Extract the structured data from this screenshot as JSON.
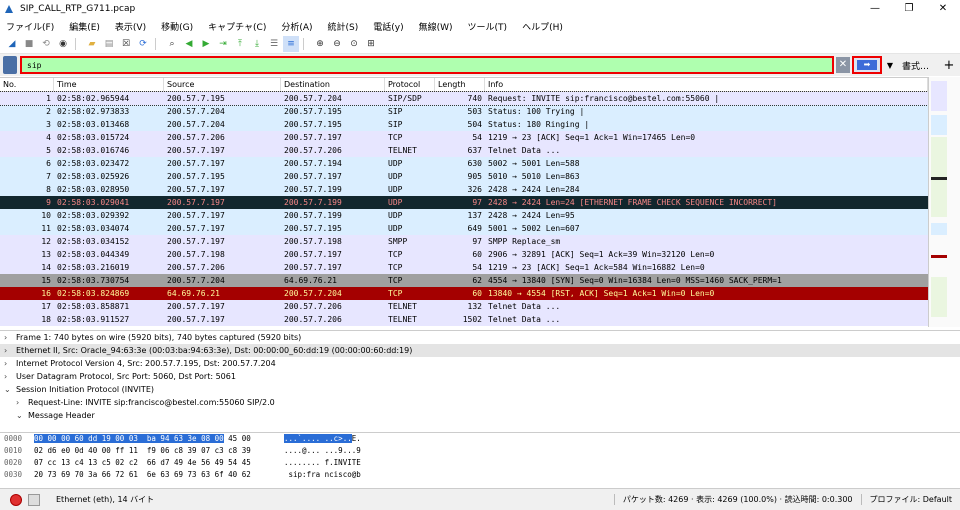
{
  "window": {
    "title": "SIP_CALL_RTP_G711.pcap",
    "controls": [
      "—",
      "❐",
      "✕"
    ]
  },
  "menu": [
    "ファイル(F)",
    "編集(E)",
    "表示(V)",
    "移動(G)",
    "キャプチャ(C)",
    "分析(A)",
    "統計(S)",
    "電話(y)",
    "無線(W)",
    "ツール(T)",
    "ヘルプ(H)"
  ],
  "toolbar_icons": [
    "shark-fin-start-icon",
    "stop-icon",
    "restart-icon",
    "options-icon",
    "open-icon",
    "save-icon",
    "close-icon",
    "reload-icon",
    "find-icon",
    "back-icon",
    "forward-icon",
    "goto-icon",
    "first-icon",
    "last-icon",
    "autoscroll-icon",
    "colorize-icon",
    "zoom-in-icon",
    "zoom-out-icon",
    "zoom-normal-icon",
    "resize-columns-icon"
  ],
  "filter": {
    "value": "sip",
    "format_label": "書式…",
    "plus": "+"
  },
  "columns": [
    "No.",
    "Time",
    "Source",
    "Destination",
    "Protocol",
    "Length",
    "Info"
  ],
  "packets": [
    {
      "no": "1",
      "time": "02:58:02.965944",
      "src": "200.57.7.195",
      "dst": "200.57.7.204",
      "proto": "SIP/SDP",
      "len": "740",
      "info": "Request: INVITE sip:francisco@bestel.com:55060 |",
      "bg": "#e7e6ff",
      "fg": "#000"
    },
    {
      "no": "2",
      "time": "02:58:02.973833",
      "src": "200.57.7.204",
      "dst": "200.57.7.195",
      "proto": "SIP",
      "len": "503",
      "info": "Status: 100 Trying |",
      "bg": "#daeeff",
      "fg": "#000"
    },
    {
      "no": "3",
      "time": "02:58:03.013468",
      "src": "200.57.7.204",
      "dst": "200.57.7.195",
      "proto": "SIP",
      "len": "504",
      "info": "Status: 180 Ringing |",
      "bg": "#daeeff",
      "fg": "#000"
    },
    {
      "no": "4",
      "time": "02:58:03.015724",
      "src": "200.57.7.206",
      "dst": "200.57.7.197",
      "proto": "TCP",
      "len": "54",
      "info": "1219 → 23 [ACK] Seq=1 Ack=1 Win=17465 Len=0",
      "bg": "#e7e6ff",
      "fg": "#000"
    },
    {
      "no": "5",
      "time": "02:58:03.016746",
      "src": "200.57.7.197",
      "dst": "200.57.7.206",
      "proto": "TELNET",
      "len": "637",
      "info": "Telnet Data ...",
      "bg": "#e7e6ff",
      "fg": "#000"
    },
    {
      "no": "6",
      "time": "02:58:03.023472",
      "src": "200.57.7.197",
      "dst": "200.57.7.194",
      "proto": "UDP",
      "len": "630",
      "info": "5002 → 5001 Len=588",
      "bg": "#daeeff",
      "fg": "#000"
    },
    {
      "no": "7",
      "time": "02:58:03.025926",
      "src": "200.57.7.195",
      "dst": "200.57.7.197",
      "proto": "UDP",
      "len": "905",
      "info": "5010 → 5010 Len=863",
      "bg": "#daeeff",
      "fg": "#000"
    },
    {
      "no": "8",
      "time": "02:58:03.028950",
      "src": "200.57.7.197",
      "dst": "200.57.7.199",
      "proto": "UDP",
      "len": "326",
      "info": "2428 → 2424 Len=284",
      "bg": "#daeeff",
      "fg": "#000"
    },
    {
      "no": "9",
      "time": "02:58:03.029041",
      "src": "200.57.7.197",
      "dst": "200.57.7.199",
      "proto": "UDP",
      "len": "97",
      "info": "2428 → 2424 Len=24 [ETHERNET FRAME CHECK SEQUENCE INCORRECT]",
      "bg": "#12272e",
      "fg": "#f78787"
    },
    {
      "no": "10",
      "time": "02:58:03.029392",
      "src": "200.57.7.197",
      "dst": "200.57.7.199",
      "proto": "UDP",
      "len": "137",
      "info": "2428 → 2424 Len=95",
      "bg": "#daeeff",
      "fg": "#000"
    },
    {
      "no": "11",
      "time": "02:58:03.034074",
      "src": "200.57.7.197",
      "dst": "200.57.7.195",
      "proto": "UDP",
      "len": "649",
      "info": "5001 → 5002 Len=607",
      "bg": "#daeeff",
      "fg": "#000"
    },
    {
      "no": "12",
      "time": "02:58:03.034152",
      "src": "200.57.7.197",
      "dst": "200.57.7.198",
      "proto": "SMPP",
      "len": "97",
      "info": "SMPP Replace_sm",
      "bg": "#e7e6ff",
      "fg": "#000"
    },
    {
      "no": "13",
      "time": "02:58:03.044349",
      "src": "200.57.7.198",
      "dst": "200.57.7.197",
      "proto": "TCP",
      "len": "60",
      "info": "2906 → 32891 [ACK] Seq=1 Ack=39 Win=32120 Len=0",
      "bg": "#e7e6ff",
      "fg": "#000"
    },
    {
      "no": "14",
      "time": "02:58:03.216019",
      "src": "200.57.7.206",
      "dst": "200.57.7.197",
      "proto": "TCP",
      "len": "54",
      "info": "1219 → 23 [ACK] Seq=1 Ack=584 Win=16882 Len=0",
      "bg": "#e7e6ff",
      "fg": "#000"
    },
    {
      "no": "15",
      "time": "02:58:03.730754",
      "src": "200.57.7.204",
      "dst": "64.69.76.21",
      "proto": "TCP",
      "len": "62",
      "info": "4554 → 13840 [SYN] Seq=0 Win=16384 Len=0 MSS=1460 SACK_PERM=1",
      "bg": "#a0a0a0",
      "fg": "#000"
    },
    {
      "no": "16",
      "time": "02:58:03.824869",
      "src": "64.69.76.21",
      "dst": "200.57.7.204",
      "proto": "TCP",
      "len": "60",
      "info": "13840 → 4554 [RST, ACK] Seq=1 Ack=1 Win=0 Len=0",
      "bg": "#a40000",
      "fg": "#fffc9c"
    },
    {
      "no": "17",
      "time": "02:58:03.858871",
      "src": "200.57.7.197",
      "dst": "200.57.7.206",
      "proto": "TELNET",
      "len": "132",
      "info": "Telnet Data ...",
      "bg": "#e7e6ff",
      "fg": "#000"
    },
    {
      "no": "18",
      "time": "02:58:03.911527",
      "src": "200.57.7.197",
      "dst": "200.57.7.206",
      "proto": "TELNET",
      "len": "1502",
      "info": "Telnet Data ...",
      "bg": "#e7e6ff",
      "fg": "#000"
    }
  ],
  "details": [
    {
      "arrow": "›",
      "text": "Frame 1: 740 bytes on wire (5920 bits), 740 bytes captured (5920 bits)",
      "indent": 0,
      "selected": false
    },
    {
      "arrow": "›",
      "text": "Ethernet II, Src: Oracle_94:63:3e (00:03:ba:94:63:3e), Dst: 00:00:00_60:dd:19 (00:00:00:60:dd:19)",
      "indent": 0,
      "selected": true
    },
    {
      "arrow": "›",
      "text": "Internet Protocol Version 4, Src: 200.57.7.195, Dst: 200.57.7.204",
      "indent": 0,
      "selected": false
    },
    {
      "arrow": "›",
      "text": "User Datagram Protocol, Src Port: 5060, Dst Port: 5061",
      "indent": 0,
      "selected": false
    },
    {
      "arrow": "⌄",
      "text": "Session Initiation Protocol (INVITE)",
      "indent": 0,
      "selected": false
    },
    {
      "arrow": "›",
      "text": "Request-Line: INVITE sip:francisco@bestel.com:55060 SIP/2.0",
      "indent": 1,
      "selected": false
    },
    {
      "arrow": "⌄",
      "text": "Message Header",
      "indent": 1,
      "selected": false
    }
  ],
  "hex": [
    {
      "off": "0000",
      "bytes": "00 00 00 60 dd 19 00 03  ba 94 63 3e 08 00 45 00",
      "hl": "00 00 00 60 dd 19 00 03  ba 94 63 3e 08 00",
      "rest": " 45 00",
      "asc_hl": "...`.... ..c>..",
      "asc_rest": "E."
    },
    {
      "off": "0010",
      "bytes": "02 d6 e0 0d 40 00 ff 11  f9 06 c8 39 07 c3 c8 39",
      "hl": "",
      "rest": "02 d6 e0 0d 40 00 ff 11  f9 06 c8 39 07 c3 c8 39",
      "asc_hl": "",
      "asc_rest": "....@... ...9...9"
    },
    {
      "off": "0020",
      "bytes": "07 cc 13 c4 13 c5 02 c2  66 d7 49 4e 56 49 54 45",
      "hl": "",
      "rest": "07 cc 13 c4 13 c5 02 c2  66 d7 49 4e 56 49 54 45",
      "asc_hl": "",
      "asc_rest": "........ f.INVITE"
    },
    {
      "off": "0030",
      "bytes": "20 73 69 70 3a 66 72 61  6e 63 69 73 63 6f 40 62",
      "hl": "",
      "rest": "20 73 69 70 3a 66 72 61  6e 63 69 73 63 6f 40 62",
      "asc_hl": "",
      "asc_rest": " sip:fra ncisco@b"
    }
  ],
  "status": {
    "left": "Ethernet (eth), 14 バイト",
    "packets": "パケット数: 4269 · 表示: 4269 (100.0%) · 読込時間: 0:0.300",
    "profile": "プロファイル: Default"
  },
  "colors": {
    "filter_bg": "#afffaf",
    "highlight": "#e00000",
    "hex_select": "#2a6dd6"
  }
}
